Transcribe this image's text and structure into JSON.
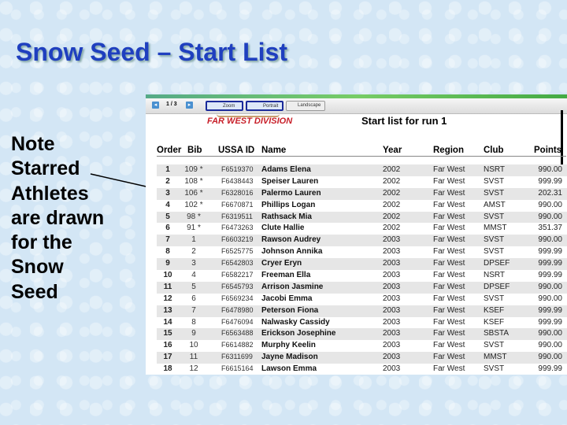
{
  "slide": {
    "title": "Snow Seed – Start List",
    "note": "Note Starred Athletes are drawn for the Snow Seed"
  },
  "toolbar": {
    "page": "1 / 3",
    "zoom": "Zoom",
    "portrait": "Portrait",
    "landscape": "Landscape"
  },
  "report": {
    "org": "FAR WEST DIVISION",
    "title": "Start list for run 1"
  },
  "columns": [
    "Order",
    "Bib",
    "USSA ID",
    "Name",
    "Year",
    "Region",
    "Club",
    "Points"
  ],
  "rows": [
    [
      "1",
      "109 *",
      "F6519370",
      "Adams Elena",
      "2002",
      "Far West",
      "NSRT",
      "990.00"
    ],
    [
      "2",
      "108 *",
      "F6438443",
      "Speiser Lauren",
      "2002",
      "Far West",
      "SVST",
      "999.99"
    ],
    [
      "3",
      "106 *",
      "F6328016",
      "Palermo Lauren",
      "2002",
      "Far West",
      "SVST",
      "202.31"
    ],
    [
      "4",
      "102 *",
      "F6670871",
      "Phillips Logan",
      "2002",
      "Far West",
      "AMST",
      "990.00"
    ],
    [
      "5",
      "98 *",
      "F6319511",
      "Rathsack Mia",
      "2002",
      "Far West",
      "SVST",
      "990.00"
    ],
    [
      "6",
      "91 *",
      "F6473263",
      "Clute Hallie",
      "2002",
      "Far West",
      "MMST",
      "351.37"
    ],
    [
      "7",
      "1",
      "F6603219",
      "Rawson Audrey",
      "2003",
      "Far West",
      "SVST",
      "990.00"
    ],
    [
      "8",
      "2",
      "F6525775",
      "Johnson Annika",
      "2003",
      "Far West",
      "SVST",
      "999.99"
    ],
    [
      "9",
      "3",
      "F6542803",
      "Cryer Eryn",
      "2003",
      "Far West",
      "DPSEF",
      "999.99"
    ],
    [
      "10",
      "4",
      "F6582217",
      "Freeman Ella",
      "2003",
      "Far West",
      "NSRT",
      "999.99"
    ],
    [
      "11",
      "5",
      "F6545793",
      "Arrison Jasmine",
      "2003",
      "Far West",
      "DPSEF",
      "990.00"
    ],
    [
      "12",
      "6",
      "F6569234",
      "Jacobi Emma",
      "2003",
      "Far West",
      "SVST",
      "990.00"
    ],
    [
      "13",
      "7",
      "F6478980",
      "Peterson Fiona",
      "2003",
      "Far West",
      "KSEF",
      "999.99"
    ],
    [
      "14",
      "8",
      "F6476094",
      "Nalwasky Cassidy",
      "2003",
      "Far West",
      "KSEF",
      "999.99"
    ],
    [
      "15",
      "9",
      "F6563488",
      "Erickson Josephine",
      "2003",
      "Far West",
      "SBSTA",
      "990.00"
    ],
    [
      "16",
      "10",
      "F6614882",
      "Murphy Keelin",
      "2003",
      "Far West",
      "SVST",
      "990.00"
    ],
    [
      "17",
      "11",
      "F6311699",
      "Jayne Madison",
      "2003",
      "Far West",
      "MMST",
      "990.00"
    ],
    [
      "18",
      "12",
      "F6615164",
      "Lawson Emma",
      "2003",
      "Far West",
      "SVST",
      "999.99"
    ]
  ]
}
